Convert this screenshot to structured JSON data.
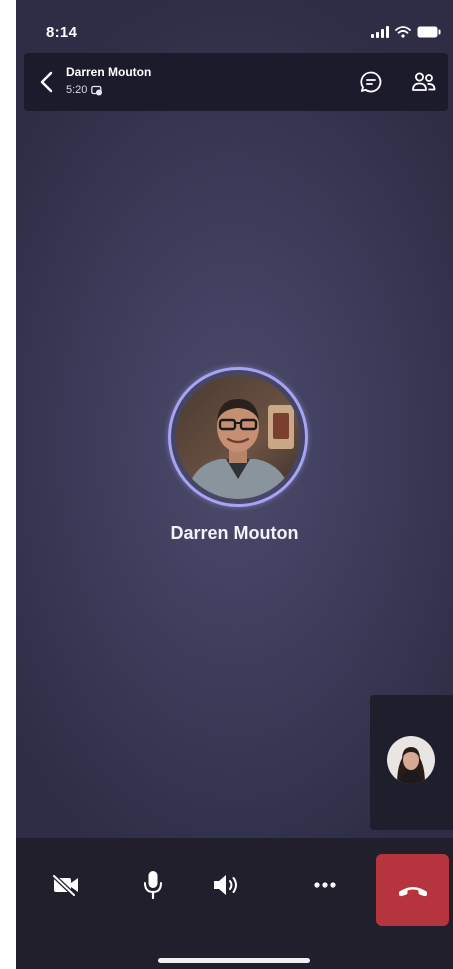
{
  "status_bar": {
    "time": "8:14",
    "icons": [
      "signal-icon",
      "wifi-icon",
      "battery-icon"
    ]
  },
  "header": {
    "caller_name": "Darren Mouton",
    "duration": "5:20",
    "icons": [
      "back-chevron-icon",
      "call-status-icon",
      "chat-icon",
      "people-icon"
    ]
  },
  "main": {
    "participant_name": "Darren Mouton",
    "ring_color": "#a7a3f5"
  },
  "controls": {
    "icons": [
      "camera-off-icon",
      "microphone-icon",
      "speaker-icon",
      "more-icon",
      "hang-up-icon"
    ],
    "end_call_color": "#b5343d"
  },
  "colors": {
    "background": "#3f3d5c",
    "header": "#1c1b2b",
    "control_bar": "#201f2b"
  }
}
